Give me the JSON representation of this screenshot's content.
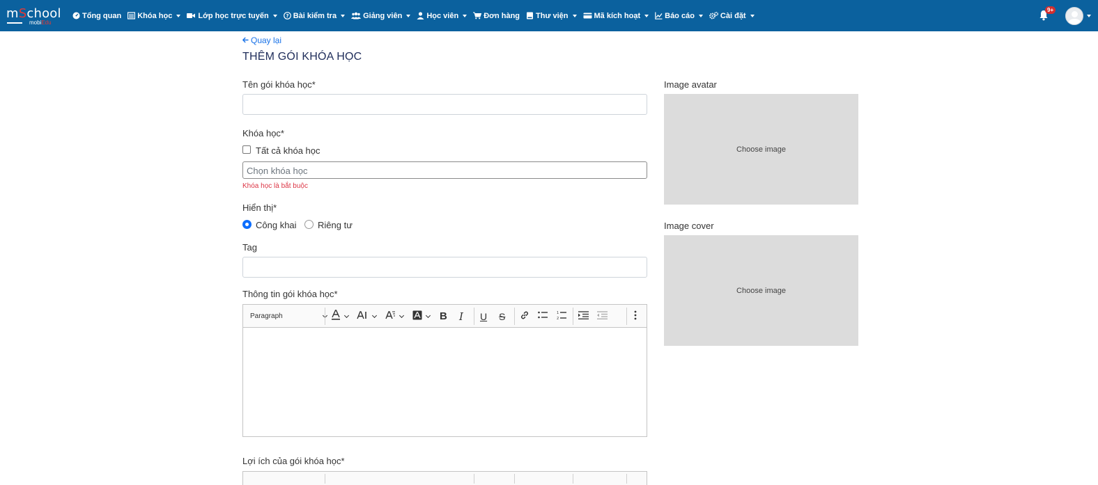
{
  "brand": {
    "logo_main_a": "m",
    "logo_main_b": "S",
    "logo_main_c": "chool",
    "logo_sub_a": "mobi",
    "logo_sub_b": "Edu"
  },
  "nav": {
    "items": [
      {
        "label": "Tổng quan",
        "icon": "dashboard-icon",
        "dropdown": false
      },
      {
        "label": "Khóa học",
        "icon": "list-icon",
        "dropdown": true
      },
      {
        "label": "Lớp học trực tuyến",
        "icon": "video-icon",
        "dropdown": true
      },
      {
        "label": "Bài kiểm tra",
        "icon": "question-icon",
        "dropdown": true
      },
      {
        "label": "Giảng viên",
        "icon": "users-icon",
        "dropdown": true
      },
      {
        "label": "Học viên",
        "icon": "user-icon",
        "dropdown": true
      },
      {
        "label": "Đơn hàng",
        "icon": "cart-icon",
        "dropdown": false
      },
      {
        "label": "Thư viện",
        "icon": "book-icon",
        "dropdown": true
      },
      {
        "label": "Mã kích hoạt",
        "icon": "card-icon",
        "dropdown": true
      },
      {
        "label": "Báo cáo",
        "icon": "chart-icon",
        "dropdown": true
      },
      {
        "label": "Cài đặt",
        "icon": "gears-icon",
        "dropdown": true
      }
    ],
    "notification_badge": "9+"
  },
  "page": {
    "back_label": "Quay lại",
    "title": "THÊM GÓI KHÓA HỌC"
  },
  "form": {
    "name_label": "Tên gói khóa học*",
    "name_value": "",
    "course_label": "Khóa học*",
    "all_courses_label": "Tất cả khóa học",
    "all_courses_checked": false,
    "course_placeholder": "Chọn khóa học",
    "course_error": "Khóa học là bắt buộc",
    "visibility_label": "Hiển thị*",
    "visibility_options": [
      {
        "label": "Công khai",
        "checked": true
      },
      {
        "label": "Riêng tư",
        "checked": false
      }
    ],
    "tag_label": "Tag",
    "tag_value": "",
    "info_label": "Thông tin gói khóa học*",
    "benefits_label": "Lợi ích của gói khóa học*"
  },
  "editor": {
    "paragraph_label": "Paragraph"
  },
  "images": {
    "avatar_label": "Image avatar",
    "avatar_button": "Choose image",
    "cover_label": "Image cover",
    "cover_button": "Choose image"
  },
  "colors": {
    "navbar": "#0b619e",
    "accent": "#0d6efd",
    "link": "#1a73e8",
    "error": "#dc3545",
    "title": "#1f2d5a",
    "image_placeholder": "#dcdcdc"
  }
}
